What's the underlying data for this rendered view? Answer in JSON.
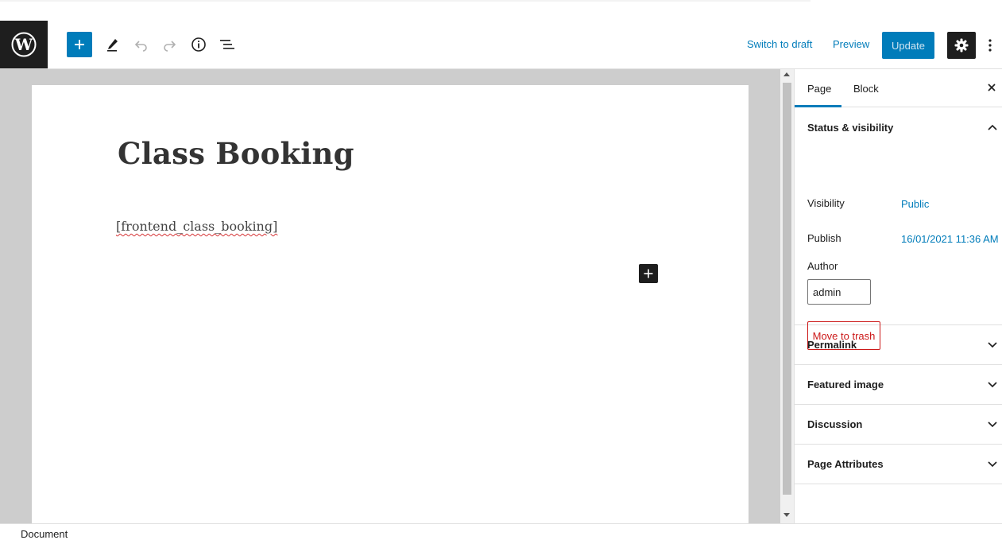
{
  "header": {
    "switch_to_draft": "Switch to draft",
    "preview": "Preview",
    "update": "Update",
    "icons": [
      "wordpress-logo",
      "plus-icon",
      "pencil-icon",
      "undo-icon",
      "redo-icon",
      "info-icon",
      "list-outline-icon",
      "gear-icon",
      "more-vertical-icon"
    ]
  },
  "editor": {
    "title": "Class Booking",
    "shortcode": "[frontend_class_booking]"
  },
  "sidebar": {
    "tabs": [
      {
        "label": "Page",
        "active": true
      },
      {
        "label": "Block",
        "active": false
      }
    ],
    "status_panel": {
      "heading": "Status & visibility",
      "visibility_label": "Visibility",
      "visibility_value": "Public",
      "publish_label": "Publish",
      "publish_value": "16/01/2021 11:36 AM",
      "author_label": "Author",
      "author_value": "admin",
      "trash_label": "Move to trash"
    },
    "panels": [
      {
        "label": "Permalink"
      },
      {
        "label": "Featured image"
      },
      {
        "label": "Discussion"
      },
      {
        "label": "Page Attributes"
      }
    ]
  },
  "footer": {
    "breadcrumb": "Document"
  },
  "colors": {
    "accent": "#007cba",
    "dark": "#1e1e1e",
    "danger": "#cc1818",
    "canvas": "#cdcdcd"
  }
}
